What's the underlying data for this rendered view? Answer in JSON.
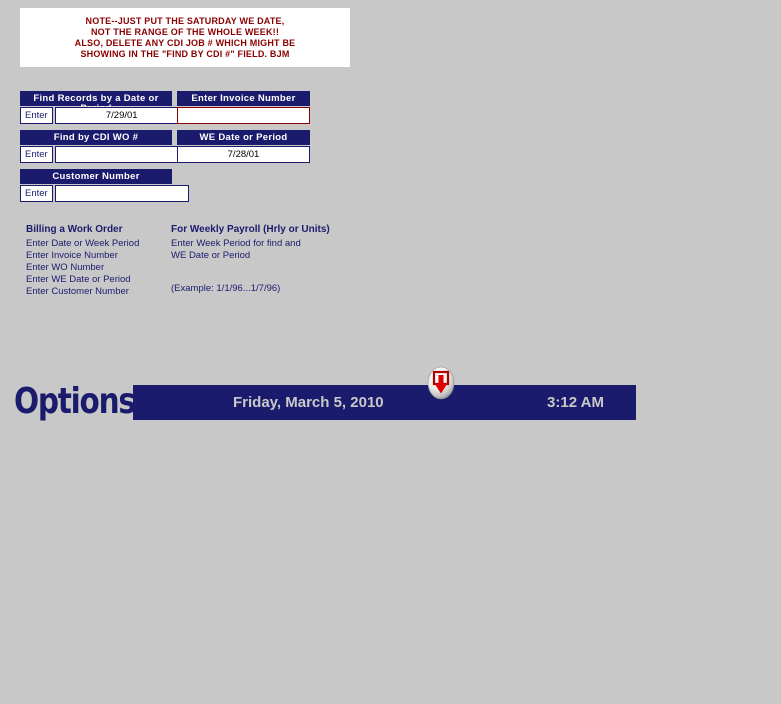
{
  "note": {
    "lines": [
      "NOTE--JUST PUT THE SATURDAY WE DATE,",
      "NOT THE RANGE OF THE WHOLE WEEK!!",
      "ALSO, DELETE ANY CDI JOB # WHICH MIGHT BE",
      "SHOWING IN THE \"FIND BY CDI #\" FIELD.  BJM"
    ]
  },
  "form": {
    "left_column": [
      {
        "header": "Find Records by a Date or Period",
        "button_label": "Enter",
        "value": "7/29/01",
        "placeholder": ""
      },
      {
        "header": "Find by CDI WO #",
        "button_label": "Enter",
        "value": "",
        "placeholder": ""
      },
      {
        "header": "Customer Number",
        "button_label": "Enter",
        "value": "",
        "placeholder": ""
      }
    ],
    "right_column": [
      {
        "header": "Enter Invoice Number",
        "value": "",
        "placeholder": ""
      },
      {
        "header": "WE Date or Period",
        "value": "7/28/01",
        "placeholder": ""
      }
    ]
  },
  "instructions": {
    "billing": {
      "title": "Billing a Work Order",
      "lines": [
        "Enter Date or Week Period",
        "Enter Invoice Number",
        "Enter WO Number",
        "Enter WE Date or Period",
        "Enter Customer Number"
      ]
    },
    "payroll": {
      "title": "For Weekly Payroll (Hrly or Units)",
      "lines": [
        "Enter Week Period for find and",
        "WE Date or Period"
      ],
      "example": "(Example: 1/1/96...1/7/96)"
    }
  },
  "options_bar": {
    "label": "Options",
    "date": "Friday, March 5, 2010",
    "time": "3:12 AM"
  },
  "cursor": {
    "name": "drop-insert-cursor"
  },
  "colors": {
    "navy": "#1b1b6e",
    "dark_red": "#8b0000",
    "background": "#c8c8c8",
    "bar_text": "#c9c9c9"
  }
}
